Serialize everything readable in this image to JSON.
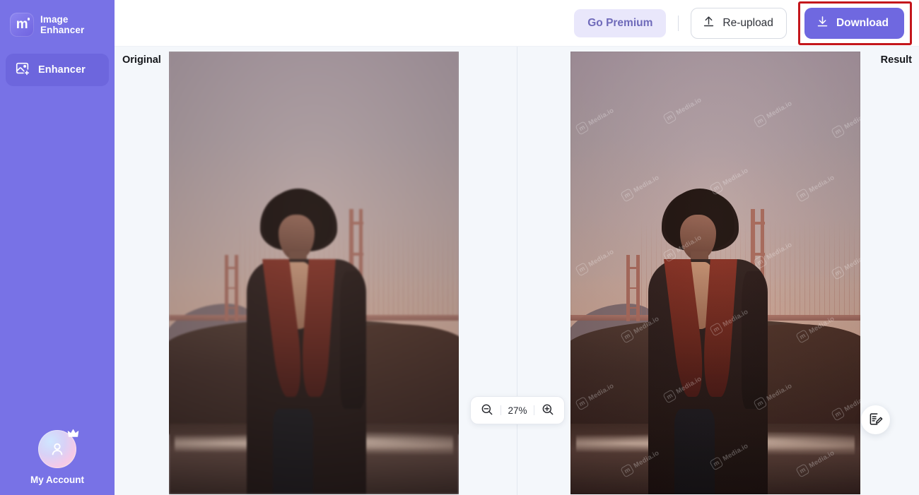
{
  "app": {
    "brand_line1": "Image",
    "brand_line2": "Enhancer",
    "logo_glyph": "m"
  },
  "sidebar": {
    "items": [
      {
        "label": "Enhancer",
        "icon": "image-plus-icon",
        "active": true
      }
    ],
    "account": {
      "label": "My Account",
      "icon": "user-avatar-icon",
      "badge_icon": "crown-icon"
    }
  },
  "toolbar": {
    "go_premium_label": "Go Premium",
    "reupload_label": "Re-upload",
    "reupload_icon": "upload-icon",
    "download_label": "Download",
    "download_icon": "download-icon",
    "highlight_color": "#c4161c",
    "accent_color": "#6f68e0",
    "premium_bg_color": "#e9e7fb"
  },
  "canvas": {
    "original_label": "Original",
    "result_label": "Result",
    "watermark_text": "Media.io",
    "watermark_glyph": "m"
  },
  "zoom_control": {
    "zoom_out_icon": "zoom-out-icon",
    "zoom_in_icon": "zoom-in-icon",
    "value": "27%"
  },
  "feedback": {
    "icon": "feedback-note-icon"
  }
}
